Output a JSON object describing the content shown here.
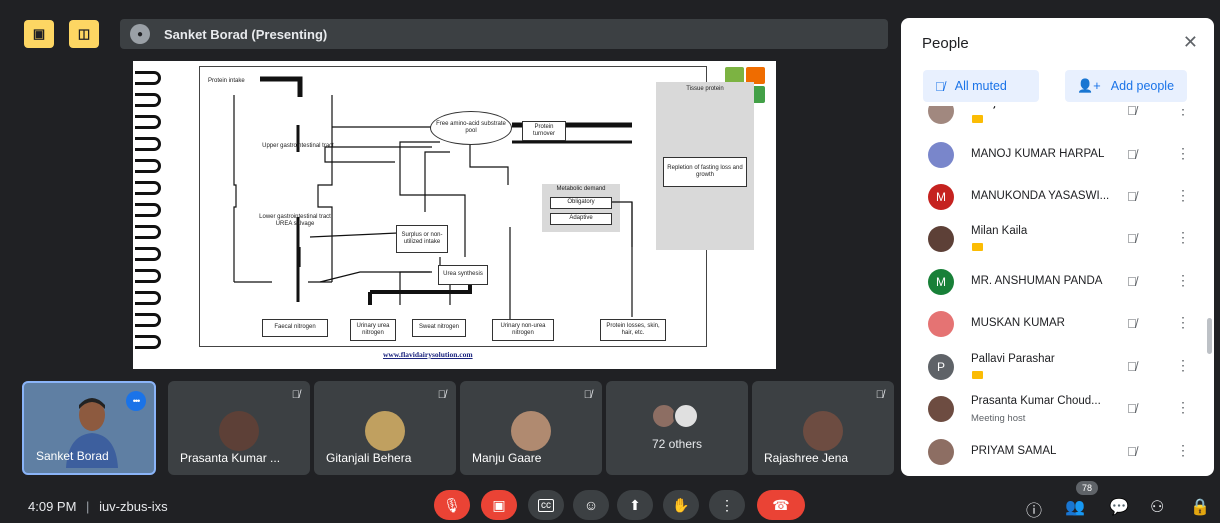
{
  "top": {
    "btn1_icon": "desktop-off-icon",
    "btn2_icon": "panel-icon",
    "presenting_label": "Sanket Borad (Presenting)"
  },
  "slide": {
    "fig": {
      "protein_intake": "Protein intake",
      "upper_gi": "Upper gastrointestinal tract",
      "lower_gi": "Lower gastrointestinal tract UREA salvage",
      "free_aa": "Free amino-acid substrate pool",
      "protein_turnover": "Protein turnover",
      "tissue_protein": "Tissue protein",
      "repletion": "Repletion of fasting loss and growth",
      "metabolic_demand": "Metabolic demand",
      "obligatory": "Obligatory",
      "adaptive": "Adaptive",
      "surplus": "Surplus or non-utilized intake",
      "urea_synthesis": "Urea synthesis",
      "faecal": "Faecal nitrogen",
      "urinary_urea": "Urinary urea nitrogen",
      "sweat": "Sweat nitrogen",
      "urinary_non_urea": "Urinary non-urea nitrogen",
      "protein_losses": "Protein losses, skin, hair, etc."
    },
    "source_url": "www.flavidairysolution.com"
  },
  "tiles": [
    {
      "name": "Sanket Borad"
    },
    {
      "name": "Prasanta Kumar ..."
    },
    {
      "name": "Gitanjali Behera"
    },
    {
      "name": "Manju Gaare"
    },
    {
      "name": "72 others"
    },
    {
      "name": "Rajashree Jena"
    }
  ],
  "bottom": {
    "time": "4:09 PM",
    "separator": "|",
    "meeting_code": "iuv-zbus-ixs",
    "people_count": "78"
  },
  "panel": {
    "title": "People",
    "all_muted": "All muted",
    "add_people": "Add people",
    "people": [
      {
        "name": "Manju Gaare",
        "sub": "",
        "initial": "",
        "color": "#a1887f",
        "tag": true
      },
      {
        "name": "MANOJ KUMAR HARPAL",
        "sub": "",
        "initial": "",
        "color": "#7986cb",
        "tag": false
      },
      {
        "name": "MANUKONDA YASASWI...",
        "sub": "",
        "initial": "M",
        "color": "#c5221f",
        "tag": false
      },
      {
        "name": "Milan Kaila",
        "sub": "",
        "initial": "",
        "color": "#5d4037",
        "tag": true
      },
      {
        "name": "MR. ANSHUMAN PANDA",
        "sub": "",
        "initial": "M",
        "color": "#188038",
        "tag": false
      },
      {
        "name": "MUSKAN KUMAR",
        "sub": "",
        "initial": "",
        "color": "#e57373",
        "tag": false
      },
      {
        "name": "Pallavi Parashar",
        "sub": "",
        "initial": "P",
        "color": "#5f6368",
        "tag": true
      },
      {
        "name": "Prasanta Kumar Choud...",
        "sub": "Meeting host",
        "initial": "",
        "color": "#6d4c41",
        "tag": false
      },
      {
        "name": "PRIYAM SAMAL",
        "sub": "",
        "initial": "",
        "color": "#8d6e63",
        "tag": false
      }
    ]
  }
}
